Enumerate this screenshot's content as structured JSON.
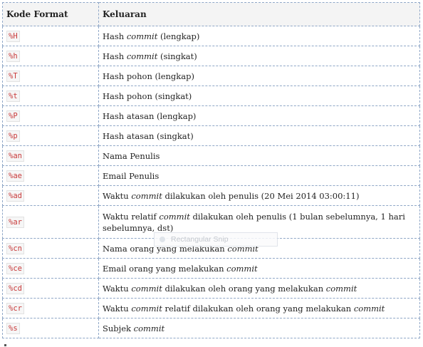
{
  "table": {
    "headers": [
      "Kode Format",
      "Keluaran"
    ],
    "rows": [
      {
        "code": "%H",
        "desc": [
          {
            "t": "Hash "
          },
          {
            "t": "commit",
            "i": true
          },
          {
            "t": " (lengkap)"
          }
        ]
      },
      {
        "code": "%h",
        "desc": [
          {
            "t": "Hash "
          },
          {
            "t": "commit",
            "i": true
          },
          {
            "t": " (singkat)"
          }
        ]
      },
      {
        "code": "%T",
        "desc": [
          {
            "t": "Hash pohon (lengkap)"
          }
        ]
      },
      {
        "code": "%t",
        "desc": [
          {
            "t": "Hash pohon (singkat)"
          }
        ]
      },
      {
        "code": "%P",
        "desc": [
          {
            "t": "Hash atasan (lengkap)"
          }
        ]
      },
      {
        "code": "%p",
        "desc": [
          {
            "t": "Hash atasan (singkat)"
          }
        ]
      },
      {
        "code": "%an",
        "desc": [
          {
            "t": "Nama Penulis"
          }
        ]
      },
      {
        "code": "%ae",
        "desc": [
          {
            "t": "Email Penulis"
          }
        ]
      },
      {
        "code": "%ad",
        "desc": [
          {
            "t": "Waktu "
          },
          {
            "t": "commit",
            "i": true
          },
          {
            "t": " dilakukan oleh penulis (20 Mei 2014 03:00:11)"
          }
        ]
      },
      {
        "code": "%ar",
        "tall": true,
        "desc": [
          {
            "t": "Waktu relatif "
          },
          {
            "t": "commit",
            "i": true
          },
          {
            "t": " dilakukan oleh penulis (1 bulan sebelumnya, 1 hari sebelumnya, dst)"
          }
        ]
      },
      {
        "code": "%cn",
        "desc": [
          {
            "t": "Nama orang yang melakukan "
          },
          {
            "t": "commit",
            "i": true
          }
        ]
      },
      {
        "code": "%ce",
        "desc": [
          {
            "t": "Email orang yang melakukan "
          },
          {
            "t": "commit",
            "i": true
          }
        ]
      },
      {
        "code": "%cd",
        "desc": [
          {
            "t": "Waktu "
          },
          {
            "t": "commit",
            "i": true
          },
          {
            "t": " dilakukan oleh orang yang melakukan "
          },
          {
            "t": "commit",
            "i": true
          }
        ]
      },
      {
        "code": "%cr",
        "desc": [
          {
            "t": "Waktu "
          },
          {
            "t": "commit",
            "i": true
          },
          {
            "t": " relatif dilakukan oleh orang yang melakukan "
          },
          {
            "t": "commit",
            "i": true
          }
        ]
      },
      {
        "code": "%s",
        "desc": [
          {
            "t": "Subjek "
          },
          {
            "t": "commit",
            "i": true
          }
        ]
      }
    ]
  },
  "overlay": {
    "label": "Rectangular Snip"
  },
  "colors": {
    "border": "#8fa7c7",
    "code_text": "#c83a3a",
    "header_bg": "#f4f4f4"
  }
}
